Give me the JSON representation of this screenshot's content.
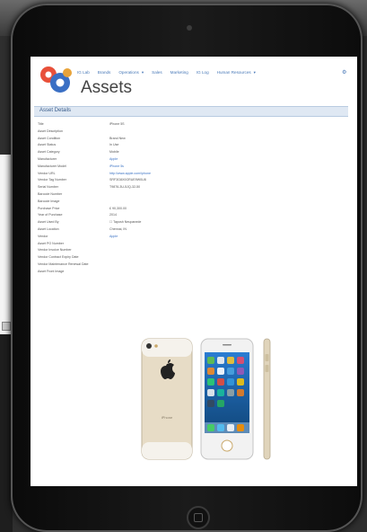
{
  "header": {
    "page_title": "Assets",
    "nav": [
      "IG Lab",
      "Brands",
      "Operations",
      "Sales",
      "Marketing",
      "IG Log",
      "Human Resources"
    ],
    "nav_carets": [
      "▾",
      "▾"
    ],
    "settings_glyph": "⚙"
  },
  "section": {
    "title": "Asset Details"
  },
  "details": [
    {
      "label": "Title",
      "value": "iPhone 5S",
      "link": false
    },
    {
      "label": "Asset Description",
      "value": "",
      "link": false
    },
    {
      "label": "Asset Condition",
      "value": "Brand New",
      "link": false
    },
    {
      "label": "Asset Status",
      "value": "In Use",
      "link": false
    },
    {
      "label": "Asset Category",
      "value": "Mobile",
      "link": false
    },
    {
      "label": "Manufacturer",
      "value": "Apple",
      "link": true
    },
    {
      "label": "Manufacturer Model",
      "value": "iPhone 5s",
      "link": true
    },
    {
      "label": "Vendor URL",
      "value": "http://www.apple.com/iphone",
      "link": true
    },
    {
      "label": "Vendor Tag Number",
      "value": "SRF3G8X0GRUE9W0U8",
      "link": false
    },
    {
      "label": "Serial Number",
      "value": "T9876-3U-5JQ-32-50",
      "link": false
    },
    {
      "label": "Barcode Number",
      "value": "",
      "link": false
    },
    {
      "label": "Barcode Image",
      "value": "",
      "link": false
    },
    {
      "label": "Purchase Price",
      "value": "£ 90,300.00",
      "link": false
    },
    {
      "label": "Year of Purchase",
      "value": "2014",
      "link": false
    },
    {
      "label": "Asset Used By",
      "value": "☐ Taposh Neupanede",
      "link": false
    },
    {
      "label": "Asset Location",
      "value": "Chennai, IN",
      "link": false
    },
    {
      "label": "Vendor",
      "value": "Apple",
      "link": true
    },
    {
      "label": "Asset PO Number",
      "value": "",
      "link": false
    },
    {
      "label": "Vendor Invoice Number",
      "value": "",
      "link": false
    },
    {
      "label": "Vendor Contract Expiry Date",
      "value": "",
      "link": false
    },
    {
      "label": "Vendor Maintenance Renewal Date",
      "value": "",
      "link": false
    },
    {
      "label": "Asset Front Image",
      "value": "",
      "link": false
    }
  ],
  "colors": {
    "accent": "#4a7ab8",
    "section_bg": "#dfe8f3",
    "link": "#3a72c4"
  },
  "icons": [
    "logo-gears",
    "settings-icon",
    "camera-dot",
    "home-button"
  ]
}
